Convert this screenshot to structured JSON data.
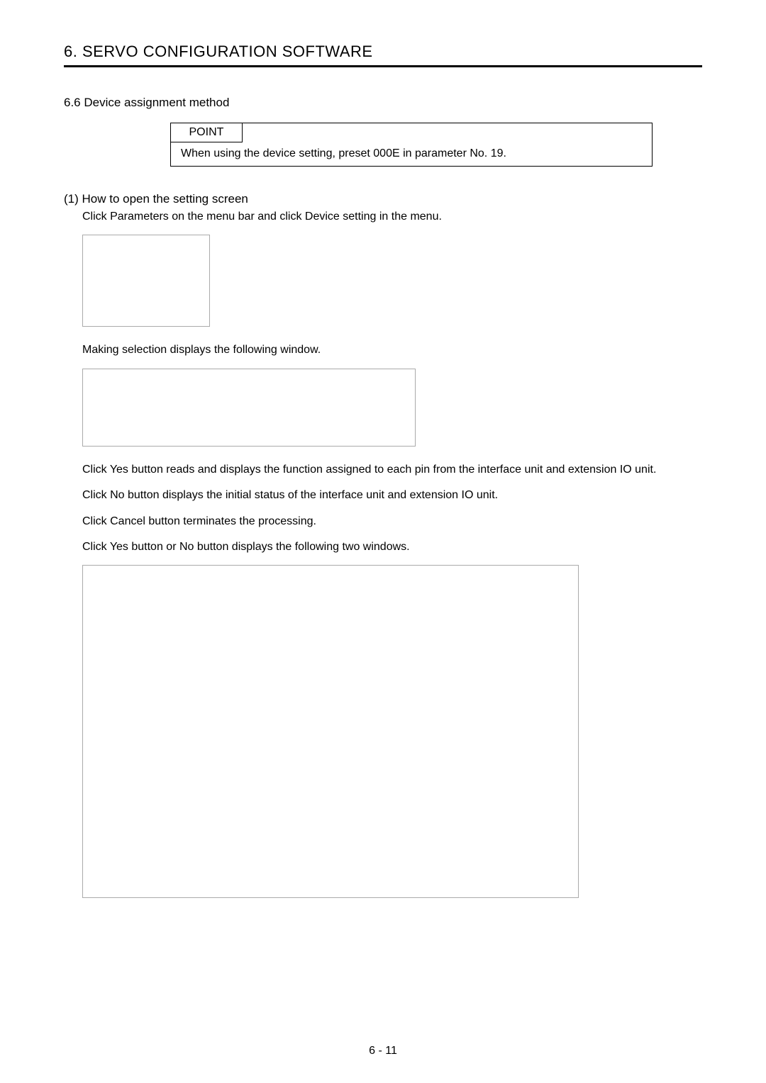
{
  "chapterTitle": "6. SERVO CONFIGURATION SOFTWARE",
  "sectionHeading": "6.6 Device assignment method",
  "pointLabel": "POINT",
  "pointBody": "When using the device setting, preset  000E  in parameter No. 19.",
  "step1Heading": "(1) How to open the setting screen",
  "step1Line": "Click  Parameters  on the menu bar and click  Device setting  in the menu.",
  "afterFigA": "Making selection displays the following window.",
  "para1": "Click   Yes  button reads and displays the function assigned to each pin from the interface unit and extension IO unit.",
  "para2": "Click   No  button displays the initial status of the interface unit and extension IO unit.",
  "para3": "Click   Cancel  button terminates the processing.",
  "para4": "Click   Yes  button or   No  button displays the following two windows.",
  "pageNumber": "6 -  11"
}
